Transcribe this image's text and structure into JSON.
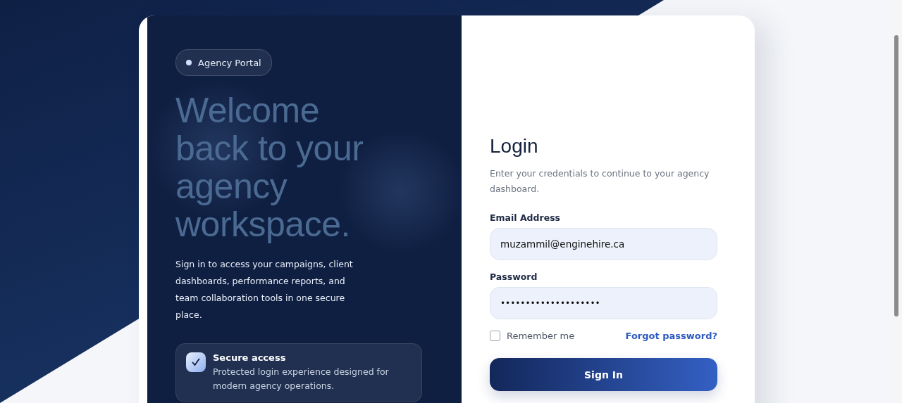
{
  "badge": {
    "label": "Agency Portal"
  },
  "hero": {
    "title": "Welcome back to your agency workspace.",
    "text": "Sign in to access your campaigns, client dashboards, performance reports, and team collaboration tools in one secure place."
  },
  "feature": {
    "title": "Secure access",
    "text": "Protected login experience designed for modern agency operations."
  },
  "login": {
    "title": "Login",
    "subtitle": "Enter your credentials to continue to your agency dashboard.",
    "fields": [
      {
        "label": "Email Address",
        "value": "muzammil@enginehire.ca"
      },
      {
        "label": "Password",
        "value": "••••••••••••••••••••"
      }
    ],
    "remember": {
      "label": "Remember me",
      "checked": false
    },
    "forgot": "Forgot password?",
    "submit": "Sign In"
  }
}
